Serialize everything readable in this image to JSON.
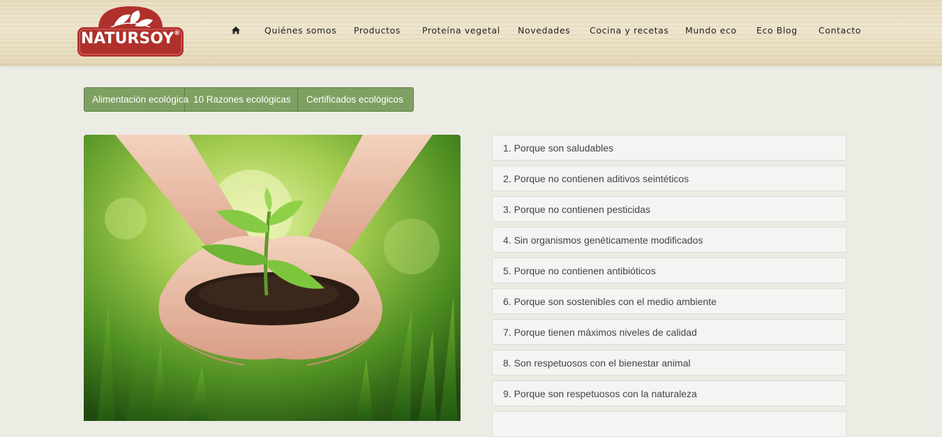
{
  "brand": {
    "name": "NATURSOY",
    "registered": "®"
  },
  "nav": {
    "home_icon": "home-icon",
    "items": [
      "Quiénes somos",
      "Productos",
      "Proteína vegetal",
      "Novedades",
      "Cocina y recetas",
      "Mundo eco",
      "Eco Blog",
      "Contacto"
    ]
  },
  "tabs": [
    "Alimentación ecológica",
    "10 Razones ecológicas",
    "Certificados ecológicos"
  ],
  "hero_image": "hands holding a seedling in soil",
  "reasons": [
    "1. Porque son saludables",
    "2. Porque no contienen aditivos seintéticos",
    "3. Porque no contienen pesticidas",
    "4. Sin organismos genéticamente modificados",
    "5. Porque no contienen antibióticos",
    "6. Porque son sostenibles con el medio ambiente",
    "7. Porque tienen máximos niveles de calidad",
    "8. Son respetuosos con el bienestar animal",
    "9. Porque son respetuosos con la naturaleza",
    ""
  ],
  "colors": {
    "tab_green": "#7ea063",
    "logo_red": "#b0302b",
    "header_wood": "#e8dcc0"
  }
}
